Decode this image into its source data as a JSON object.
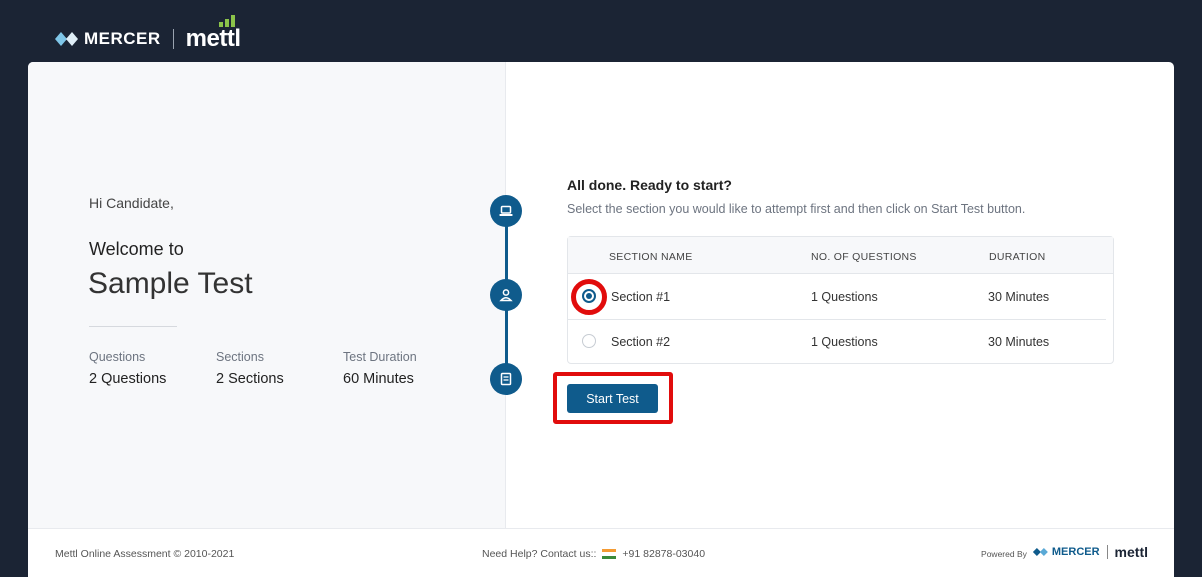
{
  "header": {
    "brand_mercer": "MERCER",
    "brand_mettl": "mettl"
  },
  "left": {
    "greeting": "Hi Candidate,",
    "welcome": "Welcome to",
    "test_name": "Sample Test",
    "stats": [
      {
        "label": "Questions",
        "value": "2 Questions"
      },
      {
        "label": "Sections",
        "value": "2 Sections"
      },
      {
        "label": "Test Duration",
        "value": "60 Minutes"
      }
    ]
  },
  "stepper": {
    "steps": [
      "laptop-icon",
      "user-icon",
      "book-icon"
    ]
  },
  "main": {
    "title": "All done. Ready to start?",
    "subtitle": "Select the section you would like to attempt first and then click on Start Test button.",
    "table": {
      "headers": [
        "SECTION NAME",
        "NO. OF QUESTIONS",
        "DURATION"
      ],
      "rows": [
        {
          "section": "Section #1",
          "questions": "1 Questions",
          "duration": "30 Minutes",
          "selected": true
        },
        {
          "section": "Section #2",
          "questions": "1 Questions",
          "duration": "30 Minutes",
          "selected": false
        }
      ]
    },
    "start_label": "Start Test"
  },
  "footer": {
    "copyright": "Mettl Online Assessment © 2010-2021",
    "help": "Need Help? Contact us::",
    "phone": "+91 82878-03040",
    "powered_by": "Powered By",
    "powered_mercer": "MERCER",
    "powered_mettl": "mettl"
  },
  "colors": {
    "primary": "#0f5b8c",
    "header_bg": "#1b2434",
    "highlight": "#e10c0c"
  }
}
